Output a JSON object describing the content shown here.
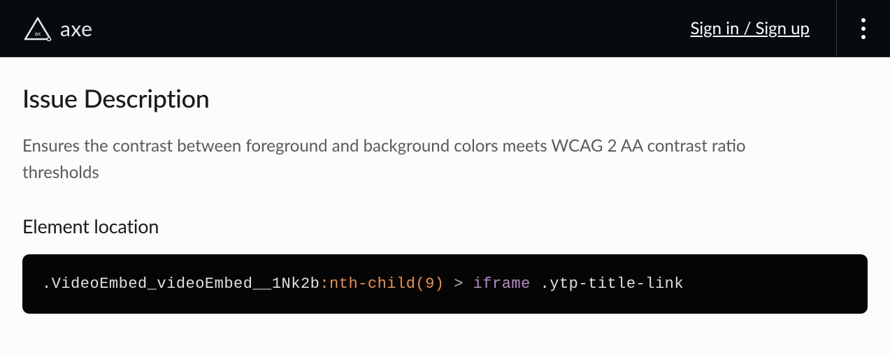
{
  "header": {
    "logo_text": "axe",
    "sign_link": "Sign in / Sign up"
  },
  "main": {
    "title": "Issue Description",
    "description": "Ensures the contrast between foreground and background colors meets WCAG 2 AA contrast ratio thresholds",
    "element_location_label": "Element location",
    "code": {
      "class1": ".VideoEmbed_videoEmbed__1Nk2b",
      "pseudo": ":nth-child(9)",
      "gt": " > ",
      "tag": "iframe",
      "space": " ",
      "class2": ".ytp-title-link"
    }
  }
}
